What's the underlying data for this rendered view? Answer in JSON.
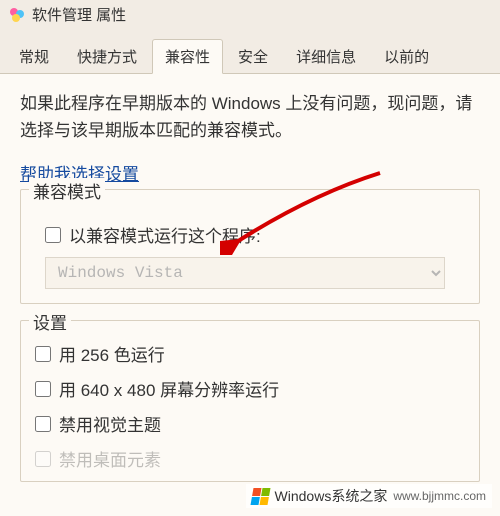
{
  "window": {
    "title": "软件管理 属性"
  },
  "tabs": {
    "general": "常规",
    "shortcut": "快捷方式",
    "compatibility": "兼容性",
    "security": "安全",
    "details": "详细信息",
    "previous": "以前的"
  },
  "compat": {
    "description": "如果此程序在早期版本的 Windows 上没有问题，现问题，请选择与该早期版本匹配的兼容模式。",
    "help_link": "帮助我选择设置",
    "mode_group_label": "兼容模式",
    "run_in_mode": "以兼容模式运行这个程序:",
    "dropdown_value": "Windows Vista"
  },
  "settings": {
    "label": "设置",
    "color256": "用 256 色运行",
    "res640": "用 640 x 480 屏幕分辨率运行",
    "disable_theme": "禁用视觉主题",
    "partial": "禁用桌面元素"
  },
  "watermark": {
    "brand": "Windows系统之家",
    "url": "www.bjjmmc.com"
  }
}
